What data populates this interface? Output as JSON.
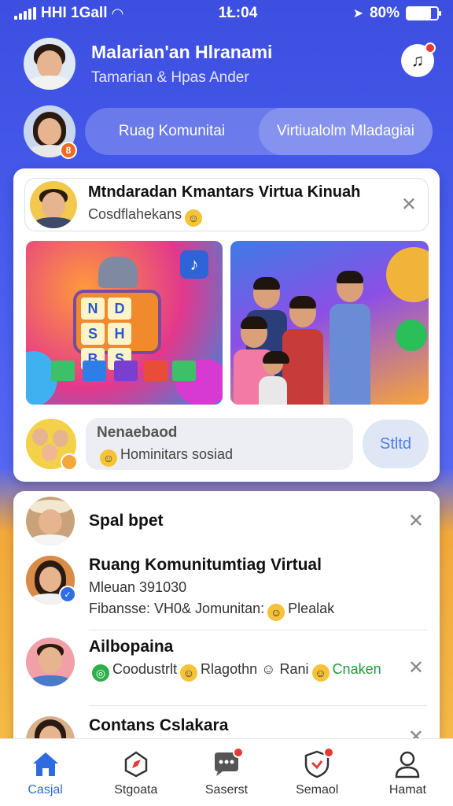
{
  "status_bar": {
    "carrier": "HHI 1Gall",
    "time": "1Ł:04",
    "battery": "80%"
  },
  "profile": {
    "name": "Malarian'an Hlranami",
    "subtitle": "Tamarian & Hpas Ander"
  },
  "tabs": {
    "items": [
      {
        "label": "Ruag Komunitai"
      },
      {
        "label": "Virtiualolm Mladagiai"
      }
    ],
    "badge": "8"
  },
  "post": {
    "title": "Mtndaradan Kmantars Virtua Kinuah",
    "subtitle": "Cosdflahekans",
    "board_letters": [
      "N",
      "D",
      "S",
      "H",
      "B",
      "S"
    ],
    "comment_title": "Nenaebaod",
    "comment_sub": "Hominitars sosiad",
    "send_label": "Stltd"
  },
  "list": {
    "items": [
      {
        "title": "Spal bpet"
      },
      {
        "title": "Ruang Komunitumtiag Virtual",
        "line1": "Mleuan 391030",
        "line2a": "Fibansse: VH0& Jomunitan:",
        "line2b": "Plealak"
      },
      {
        "title": "Ailbopaina",
        "line_a": "Coodustrlt",
        "line_b": "Rlagothn",
        "line_c": "Rani",
        "line_d": "Cnaken"
      },
      {
        "title": "Contans Cslakara"
      }
    ]
  },
  "nav": {
    "items": [
      {
        "label": "Casjal",
        "icon": "home-icon"
      },
      {
        "label": "Stgoata",
        "icon": "compass-icon"
      },
      {
        "label": "Saserst",
        "icon": "chat-icon"
      },
      {
        "label": "Semaol",
        "icon": "shield-icon"
      },
      {
        "label": "Hamat",
        "icon": "profile-icon"
      }
    ]
  },
  "colors": {
    "accent": "#2c6be0",
    "background_top": "#3c4fe0",
    "background_bottom": "#f6c04a",
    "notification": "#e53935",
    "badge": "#ef6a22"
  }
}
